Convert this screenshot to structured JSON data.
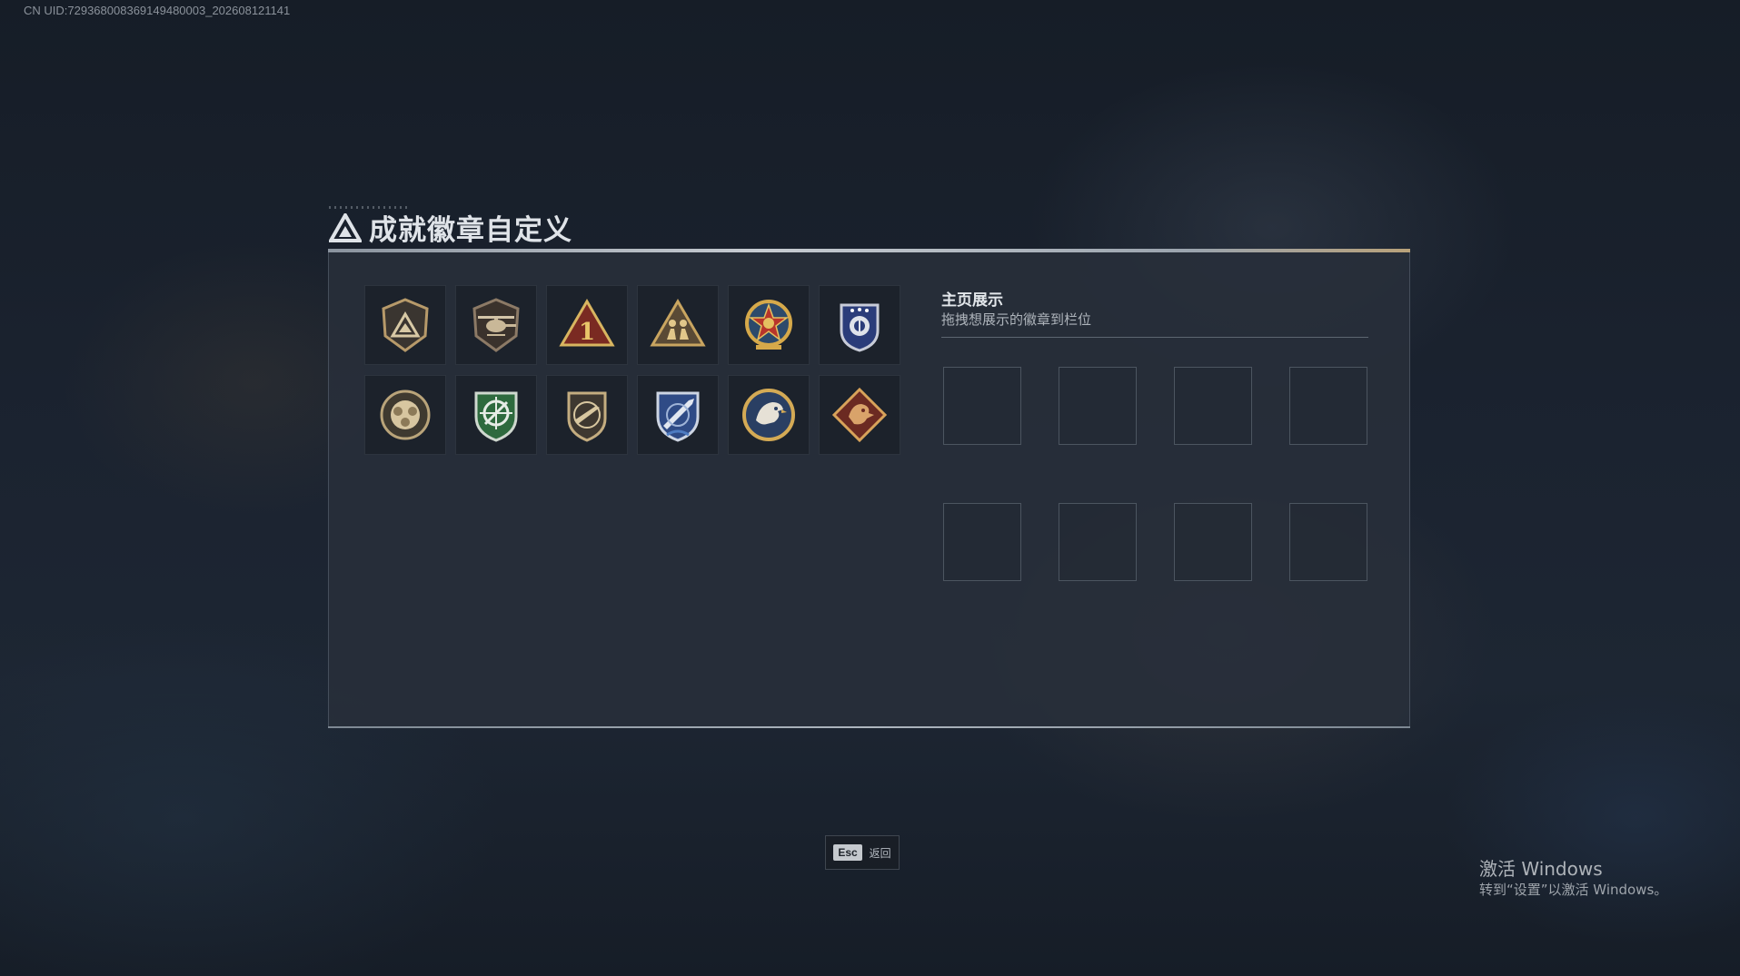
{
  "watermark": {
    "uid": "CN UID:729368008369149480003_202608121141"
  },
  "header": {
    "title": "成就徽章自定义",
    "icon": "triangle-logo-icon"
  },
  "badges": [
    {
      "icon": "shield-triangle-badge-icon"
    },
    {
      "icon": "helicopter-badge-icon"
    },
    {
      "icon": "rank-one-triangle-badge-icon"
    },
    {
      "icon": "soldiers-triangle-badge-icon"
    },
    {
      "icon": "star-medal-badge-icon"
    },
    {
      "icon": "police-shield-badge-icon"
    },
    {
      "icon": "gear-cog-badge-icon"
    },
    {
      "icon": "green-crosshair-shield-badge-icon"
    },
    {
      "icon": "rifle-shield-badge-icon"
    },
    {
      "icon": "blue-missile-shield-badge-icon"
    },
    {
      "icon": "eagle-round-badge-icon"
    },
    {
      "icon": "dragon-diamond-badge-icon"
    }
  ],
  "showcase": {
    "title": "主页展示",
    "subtitle": "拖拽想展示的徽章到栏位",
    "slot_count": 8
  },
  "footer": {
    "esc_key": "Esc",
    "esc_label": "返回"
  },
  "windows_activation": {
    "title": "激活 Windows",
    "subtitle": "转到“设置”以激活 Windows。"
  }
}
